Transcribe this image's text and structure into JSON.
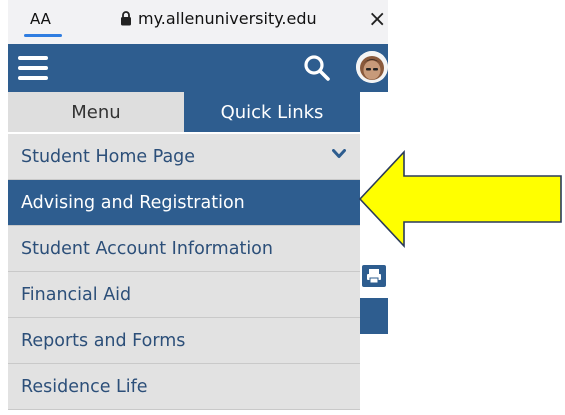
{
  "browser": {
    "text_size_label": "AA",
    "url": "my.allenuniversity.edu",
    "close_label": "×"
  },
  "tabs": [
    {
      "label": "Menu",
      "selected": false
    },
    {
      "label": "Quick Links",
      "selected": true
    }
  ],
  "menu": {
    "items": [
      {
        "label": "Student Home Page",
        "expanded": true
      },
      {
        "label": "Advising and Registration",
        "active": true
      },
      {
        "label": "Student Account Information"
      },
      {
        "label": "Financial Aid"
      },
      {
        "label": "Reports and Forms"
      },
      {
        "label": "Residence Life"
      }
    ]
  },
  "colors": {
    "primary": "#2e5d8f",
    "menu_bg": "#e2e2e2",
    "menu_text": "#2c4f79",
    "annotation_arrow": "#ffff00"
  },
  "icons": {
    "menu": "hamburger-icon",
    "search": "search-icon",
    "profile": "avatar",
    "expand": "chevron-down-icon",
    "print": "print-icon",
    "lock": "lock-icon"
  }
}
